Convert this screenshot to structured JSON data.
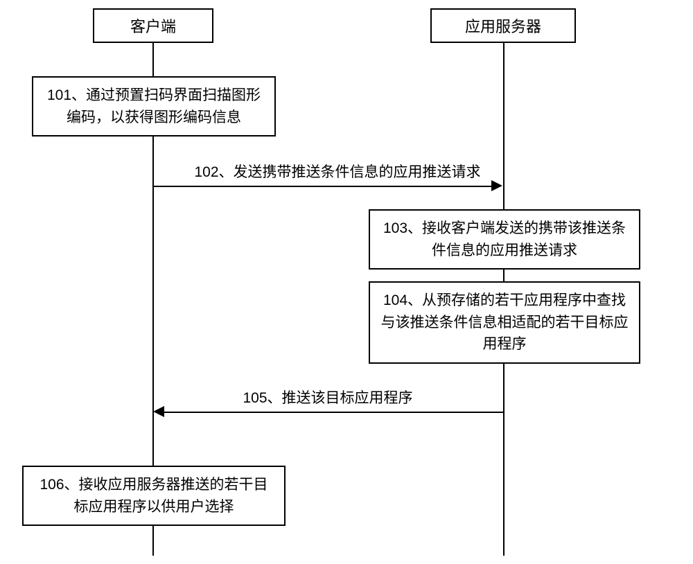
{
  "participants": {
    "client": "客户端",
    "server": "应用服务器"
  },
  "steps": {
    "s101": "101、通过预置扫码界面扫描图形编码，以获得图形编码信息",
    "s102": "102、发送携带推送条件信息的应用推送请求",
    "s103": "103、接收客户端发送的携带该推送条件信息的应用推送请求",
    "s104": "104、从预存储的若干应用程序中查找与该推送条件信息相适配的若干目标应用程序",
    "s105": "105、推送该目标应用程序",
    "s106": "106、接收应用服务器推送的若干目标应用程序以供用户选择"
  }
}
